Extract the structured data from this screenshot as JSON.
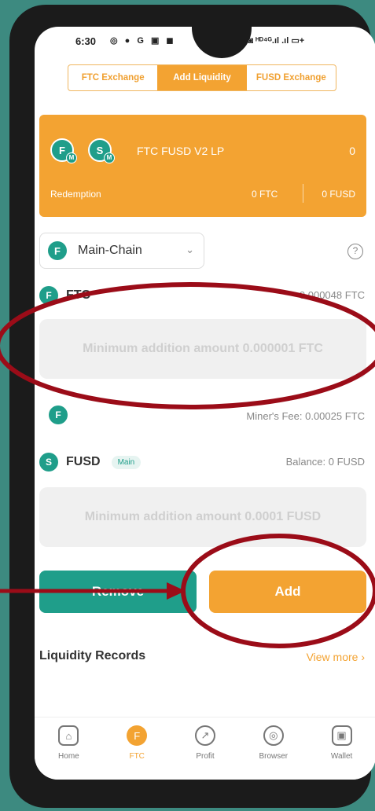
{
  "status_bar": {
    "time": "6:30",
    "left_icons": "◎ ● G ▣ ◼",
    "right_icons": "▣ ◙ ᴴᴰ⁴ᴳ.ıl .ıl ▭+"
  },
  "tabs": [
    {
      "label": "FTC Exchange",
      "active": false
    },
    {
      "label": "Add Liquidity",
      "active": true
    },
    {
      "label": "FUSD Exchange",
      "active": false
    }
  ],
  "lp_card": {
    "coin1": "F",
    "coin1_sub": "M",
    "coin2": "S",
    "coin2_sub": "M",
    "name": "FTC FUSD  V2 LP",
    "value": "0",
    "redemption_label": "Redemption",
    "redemption_ftc": "0 FTC",
    "redemption_fusd": "0 FUSD"
  },
  "chain_selector": {
    "icon": "F",
    "label": "Main-Chain",
    "chevron": "⌄"
  },
  "help_icon": "?",
  "ftc": {
    "icon": "F",
    "name": "FTC",
    "balance": "0.000048 FTC",
    "placeholder": "Minimum addition amount 0.000001 FTC",
    "fee_icon": "F",
    "miners_fee": "Miner's Fee: 0.00025 FTC"
  },
  "fusd": {
    "icon": "S",
    "name": "FUSD",
    "badge": "Main",
    "balance": "Balance: 0 FUSD",
    "placeholder": "Minimum addition amount 0.0001 FUSD"
  },
  "buttons": {
    "remove": "Remove",
    "add": "Add"
  },
  "records": {
    "title": "Liquidity Records",
    "view_more": "View more ›"
  },
  "nav": [
    {
      "label": "Home",
      "icon": "⌂",
      "active": false
    },
    {
      "label": "FTC",
      "icon": "F",
      "active": true
    },
    {
      "label": "Profit",
      "icon": "↗",
      "active": false
    },
    {
      "label": "Browser",
      "icon": "◎",
      "active": false
    },
    {
      "label": "Wallet",
      "icon": "▣",
      "active": false
    }
  ],
  "colors": {
    "accent": "#f3a332",
    "teal": "#1f9e8a",
    "annotation": "#9b0c18",
    "background": "#3d8a80"
  }
}
